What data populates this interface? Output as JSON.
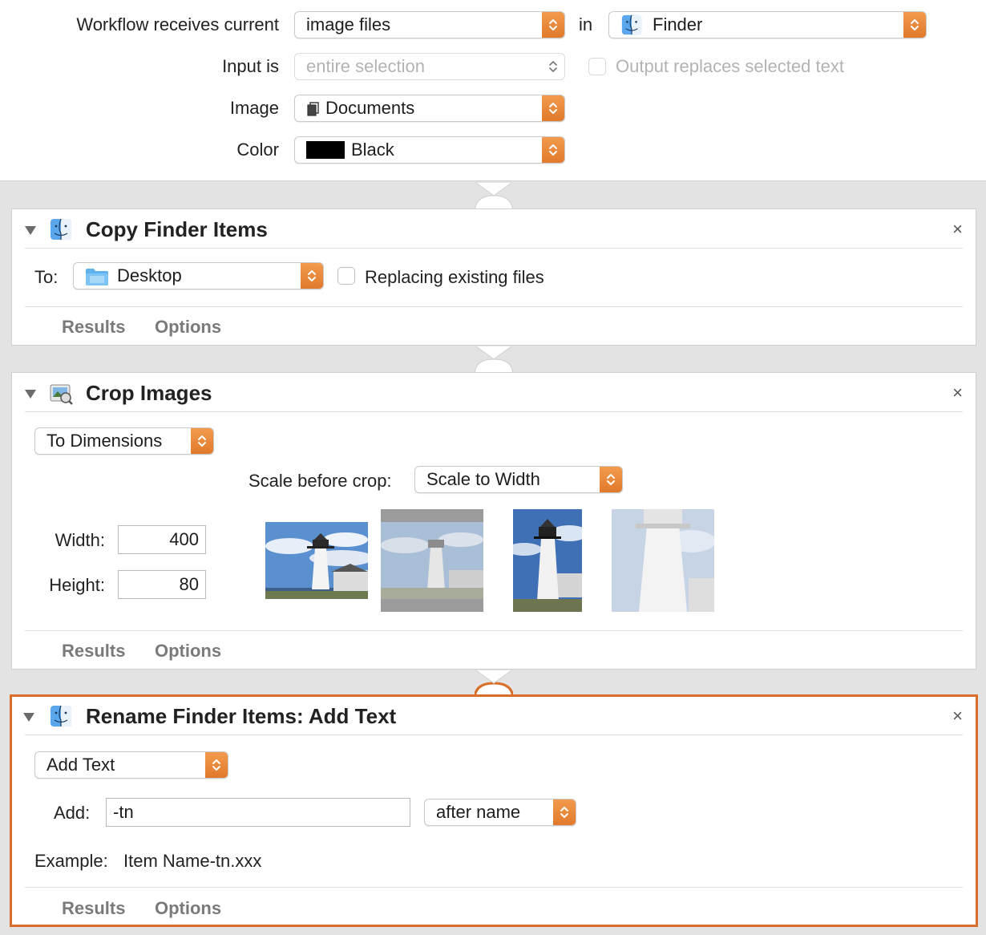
{
  "header": {
    "receives_label": "Workflow receives current",
    "receives_value": "image files",
    "in_label": "in",
    "app_value": "Finder",
    "input_label": "Input is",
    "input_value": "entire selection",
    "output_replaces": "Output replaces selected text",
    "image_label": "Image",
    "image_value": "Documents",
    "color_label": "Color",
    "color_value": "Black",
    "color_swatch": "#000000"
  },
  "actions": {
    "copy": {
      "title": "Copy Finder Items",
      "to_label": "To:",
      "to_value": "Desktop",
      "replacing_label": "Replacing existing files",
      "results": "Results",
      "options": "Options"
    },
    "crop": {
      "title": "Crop Images",
      "mode_value": "To Dimensions",
      "scale_label": "Scale before crop:",
      "scale_value": "Scale to Width",
      "width_label": "Width:",
      "width_value": "400",
      "height_label": "Height:",
      "height_value": "80",
      "results": "Results",
      "options": "Options"
    },
    "rename": {
      "title": "Rename Finder Items: Add Text",
      "mode_value": "Add Text",
      "add_label": "Add:",
      "add_value": "-tn",
      "position_value": "after name",
      "example_label": "Example:",
      "example_value": "Item Name-tn.xxx",
      "results": "Results",
      "options": "Options"
    }
  },
  "icons": {
    "close": "×",
    "disclosure": "disclosure-triangle-icon",
    "finder": "finder-icon",
    "preview": "preview-icon",
    "folder": "folder-icon",
    "documents": "documents-icon"
  },
  "colors": {
    "accent": "#e0782a",
    "selected_border": "#d86e28"
  }
}
